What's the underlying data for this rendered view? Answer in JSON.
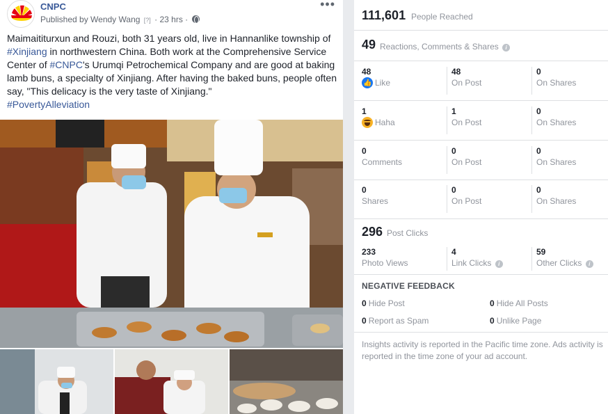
{
  "post": {
    "page_name": "CNPC",
    "published_by": "Published by Wendy Wang",
    "help_marker": "[?]",
    "time": "23 hrs",
    "separator": "·",
    "more": "•••",
    "text": {
      "p1": "Maimaititurxun and Rouzi, both 31 years old, live in Hannanlike township of ",
      "tag_xinjiang": "#Xinjiang",
      "p2": " in northwestern China. Both work at the Comprehensive Service Center of ",
      "tag_cnpc": "#CNPC",
      "p3": "'s Urumqi Petrochemical Company and are good at baking lamb buns, a specialty of Xinjiang. After having the baked buns, people often say, \"This delicacy is the very taste of Xinjiang.\"",
      "tag_poverty": "#PovertyAlleviation"
    }
  },
  "insights": {
    "reach": {
      "value": "111,601",
      "label": "People Reached"
    },
    "reactions": {
      "value": "49",
      "label": "Reactions, Comments & Shares"
    },
    "rows": [
      {
        "c1_value": "48",
        "c1_label": "Like",
        "c1_icon": "like-icon",
        "c2_value": "48",
        "c2_label": "On Post",
        "c3_value": "0",
        "c3_label": "On Shares"
      },
      {
        "c1_value": "1",
        "c1_label": "Haha",
        "c1_icon": "haha-icon",
        "c2_value": "1",
        "c2_label": "On Post",
        "c3_value": "0",
        "c3_label": "On Shares"
      },
      {
        "c1_value": "0",
        "c1_label": "Comments",
        "c2_value": "0",
        "c2_label": "On Post",
        "c3_value": "0",
        "c3_label": "On Shares"
      },
      {
        "c1_value": "0",
        "c1_label": "Shares",
        "c2_value": "0",
        "c2_label": "On Post",
        "c3_value": "0",
        "c3_label": "On Shares"
      }
    ],
    "clicks": {
      "value": "296",
      "label": "Post Clicks",
      "photo_views": {
        "value": "233",
        "label": "Photo Views"
      },
      "link_clicks": {
        "value": "4",
        "label": "Link Clicks"
      },
      "other_clicks": {
        "value": "59",
        "label": "Other Clicks"
      }
    },
    "negative": {
      "title": "NEGATIVE FEEDBACK",
      "hide_post": {
        "value": "0",
        "label": "Hide Post"
      },
      "hide_all": {
        "value": "0",
        "label": "Hide All Posts"
      },
      "spam": {
        "value": "0",
        "label": "Report as Spam"
      },
      "unlike": {
        "value": "0",
        "label": "Unlike Page"
      }
    },
    "footer": "Insights activity is reported in the Pacific time zone. Ads activity is reported in the time zone of your ad account.",
    "info_glyph": "i"
  },
  "colors": {
    "link": "#385898",
    "muted": "#90949c",
    "divider": "#dddfe2"
  }
}
